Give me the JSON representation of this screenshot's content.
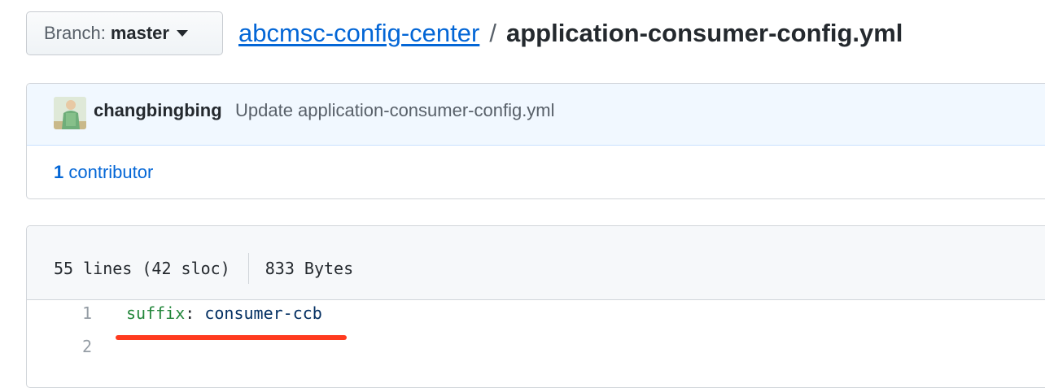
{
  "branch": {
    "label": "Branch:",
    "value": "master"
  },
  "breadcrumb": {
    "repo": "abcmsc-config-center",
    "separator": "/",
    "file": "application-consumer-config.yml"
  },
  "commit": {
    "author": "changbingbing",
    "message": "Update application-consumer-config.yml"
  },
  "contributors": {
    "count": "1",
    "label": "contributor"
  },
  "file_info": {
    "lines": "55 lines (42 sloc)",
    "size": "833 Bytes"
  },
  "code_lines": [
    {
      "number": "1",
      "key": "suffix",
      "colon": ":",
      "value": "consumer-ccb"
    },
    {
      "number": "2",
      "key": "",
      "colon": "",
      "value": ""
    }
  ],
  "colors": {
    "link": "#0366d6",
    "annotation_underline": "#ff3b1f",
    "yaml_key": "#22863a"
  }
}
